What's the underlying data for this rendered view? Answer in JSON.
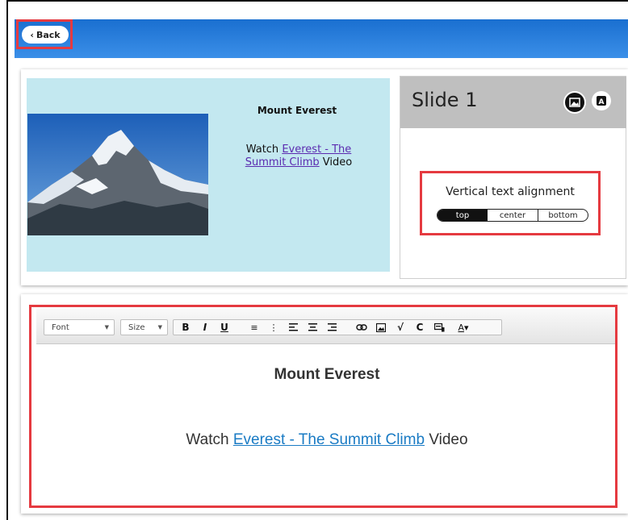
{
  "header": {
    "back_label": "Back"
  },
  "preview": {
    "image_alt": "mountain-photo",
    "title": "Mount Everest",
    "watch_prefix": "Watch",
    "link_text": "Everest - The Summit Climb",
    "watch_suffix": "Video"
  },
  "slide_panel": {
    "title": "Slide 1",
    "icons": [
      "image-icon",
      "text-icon"
    ],
    "vertical_alignment": {
      "label": "Vertical text alignment",
      "options": [
        "top",
        "center",
        "bottom"
      ],
      "selected": "top"
    }
  },
  "editor": {
    "font_dropdown": "Font",
    "size_dropdown": "Size",
    "toolbar_icons": [
      "bold-icon",
      "italic-icon",
      "underline-icon",
      "numbered-list-icon",
      "bulleted-list-icon",
      "align-left-icon",
      "align-center-icon",
      "align-right-icon",
      "link-icon",
      "image-icon",
      "math-icon",
      "refresh-icon",
      "insert-icon",
      "text-color-icon"
    ],
    "content": {
      "title": "Mount Everest",
      "watch_prefix": "Watch",
      "link_text": "Everest - The Summit Climb",
      "watch_suffix": "Video"
    }
  },
  "colors": {
    "highlight": "#e53a40",
    "topbar": "#2a7fdf",
    "preview_bg": "#c3e8f0",
    "link_preview": "#5b2bb0",
    "link_editor": "#1a7bc4"
  }
}
